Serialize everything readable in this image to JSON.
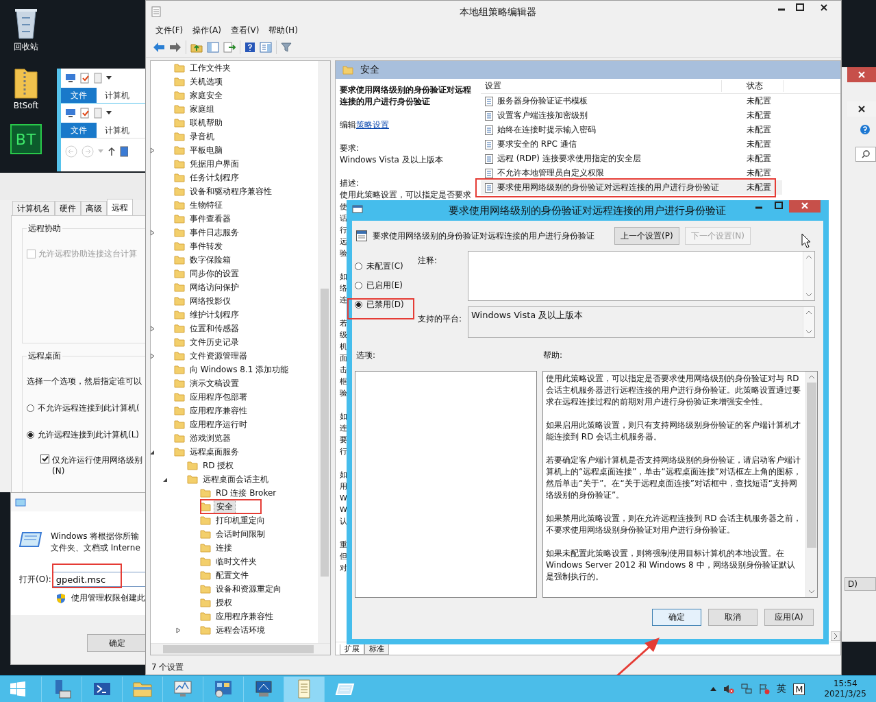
{
  "desktop": {
    "icons": [
      {
        "kind": "recycle-bin",
        "label": "回收站"
      },
      {
        "kind": "zip-folder",
        "label": "BtSoft"
      },
      {
        "kind": "tile",
        "tile_text": "BT"
      }
    ]
  },
  "explorer_windows": [
    {
      "ribbon_tabs": [
        "文件",
        "计算机"
      ]
    },
    {
      "ribbon_tabs": [
        "文件",
        "计算机"
      ]
    }
  ],
  "system_properties": {
    "tabs": [
      {
        "label": "计算机名",
        "selected": false
      },
      {
        "label": "硬件",
        "selected": false
      },
      {
        "label": "高级",
        "selected": false
      },
      {
        "label": "远程",
        "selected": true
      }
    ],
    "remote_assistance": {
      "title": "远程协助",
      "checkbox": {
        "label": "允许远程协助连接这台计算",
        "checked": false,
        "disabled": true
      }
    },
    "remote_desktop": {
      "title": "远程桌面",
      "hint": "选择一个选项，然后指定谁可以",
      "options": [
        {
          "label": "不允许远程连接到此计算机(",
          "selected": false
        },
        {
          "label": "允许远程连接到此计算机(L)",
          "selected": true
        }
      ],
      "nla_checkbox": {
        "label": "仅允许运行使用网络级别",
        "label_line2": "(N)",
        "checked": true,
        "disabled": false
      }
    }
  },
  "run_dialog": {
    "description": [
      "Windows 将根据你所输",
      "文件夹、文档或 Interne"
    ],
    "open_label": "打开(O):",
    "value": "gpedit.msc",
    "admin_note": "使用管理权限创建此",
    "ok_button": "确定"
  },
  "gpedit": {
    "title": "本地组策略编辑器",
    "menu": [
      "文件(F)",
      "操作(A)",
      "查看(V)",
      "帮助(H)"
    ],
    "tree": [
      {
        "label": "工作文件夹",
        "selected": false
      },
      {
        "label": "关机选项",
        "selected": false
      },
      {
        "label": "家庭安全",
        "selected": false
      },
      {
        "label": "家庭组",
        "selected": false
      },
      {
        "label": "联机帮助",
        "selected": false
      },
      {
        "label": "录音机",
        "selected": false
      },
      {
        "label": "平板电脑",
        "selected": false,
        "expanded": false
      },
      {
        "label": "凭据用户界面",
        "selected": false
      },
      {
        "label": "任务计划程序",
        "selected": false
      },
      {
        "label": "设备和驱动程序兼容性",
        "selected": false
      },
      {
        "label": "生物特征",
        "selected": false
      },
      {
        "label": "事件查看器",
        "selected": false
      },
      {
        "label": "事件日志服务",
        "selected": false,
        "expanded": false
      },
      {
        "label": "事件转发",
        "selected": false
      },
      {
        "label": "数字保险箱",
        "selected": false
      },
      {
        "label": "同步你的设置",
        "selected": false
      },
      {
        "label": "网络访问保护",
        "selected": false
      },
      {
        "label": "网络投影仪",
        "selected": false
      },
      {
        "label": "维护计划程序",
        "selected": false
      },
      {
        "label": "位置和传感器",
        "selected": false,
        "expanded": false
      },
      {
        "label": "文件历史记录",
        "selected": false
      },
      {
        "label": "文件资源管理器",
        "selected": false,
        "expanded": false
      },
      {
        "label": "向 Windows 8.1 添加功能",
        "selected": false
      },
      {
        "label": "演示文稿设置",
        "selected": false
      },
      {
        "label": "应用程序包部署",
        "selected": false
      },
      {
        "label": "应用程序兼容性",
        "selected": false
      },
      {
        "label": "应用程序运行时",
        "selected": false
      },
      {
        "label": "游戏浏览器",
        "selected": false
      },
      {
        "label": "远程桌面服务",
        "selected": false,
        "expanded": true,
        "children": [
          {
            "label": "RD 授权",
            "selected": false
          },
          {
            "label": "远程桌面会话主机",
            "selected": false,
            "expanded": true,
            "children": [
              {
                "label": "RD 连接 Broker",
                "selected": false
              },
              {
                "label": "安全",
                "selected": true
              },
              {
                "label": "打印机重定向",
                "selected": false
              },
              {
                "label": "会话时间限制",
                "selected": false
              },
              {
                "label": "连接",
                "selected": false
              },
              {
                "label": "临时文件夹",
                "selected": false
              },
              {
                "label": "配置文件",
                "selected": false
              },
              {
                "label": "设备和资源重定向",
                "selected": false
              },
              {
                "label": "授权",
                "selected": false
              },
              {
                "label": "应用程序兼容性",
                "selected": false
              },
              {
                "label": "远程会话环境",
                "selected": false,
                "expanded": false
              }
            ]
          }
        ]
      }
    ],
    "status": "7 个设置",
    "pane_header": "安全",
    "detail": {
      "title": "要求使用网络级别的身份验证对远程连接的用户进行身份验证",
      "edit_prefix": "编辑",
      "edit_link": "策略设置",
      "requirement_label": "要求:",
      "requirement": "Windows Vista 及以上版本",
      "description_label": "描述:",
      "description_first_line": "使用此策略设置，可以指定是否要求",
      "description_fragments": [
        [
          "使",
          "话",
          "行",
          "远",
          "验"
        ],
        [
          "如",
          "络",
          "连"
        ],
        [
          "若",
          "级",
          "机",
          "面",
          "击",
          "框",
          "验"
        ],
        [
          "如",
          "连",
          "要",
          "行"
        ],
        [
          "如",
          "用",
          "W",
          "W",
          "认"
        ],
        [
          "重",
          "但",
          "对"
        ]
      ]
    },
    "list": {
      "columns": [
        "设置",
        "状态"
      ],
      "rows": [
        {
          "name": "服务器身份验证证书模板",
          "state": "未配置",
          "selected": false
        },
        {
          "name": "设置客户端连接加密级别",
          "state": "未配置",
          "selected": false
        },
        {
          "name": "始终在连接时提示输入密码",
          "state": "未配置",
          "selected": false
        },
        {
          "name": "要求安全的 RPC 通信",
          "state": "未配置",
          "selected": false
        },
        {
          "name": "远程 (RDP) 连接要求使用指定的安全层",
          "state": "未配置",
          "selected": false
        },
        {
          "name": "不允许本地管理员自定义权限",
          "state": "未配置",
          "selected": false
        },
        {
          "name": "要求使用网络级别的身份验证对远程连接的用户进行身份验证",
          "state": "未配置",
          "selected": true
        }
      ]
    },
    "view_tabs": [
      {
        "label": "扩展",
        "selected": true
      },
      {
        "label": "标准",
        "selected": false
      }
    ]
  },
  "policy_dialog": {
    "title": "要求使用网络级别的身份验证对远程连接的用户进行身份验证",
    "heading": "要求使用网络级别的身份验证对远程连接的用户进行身份验证",
    "prev_button": {
      "label": "上一个设置(P)",
      "disabled": false
    },
    "next_button": {
      "label": "下一个设置(N)",
      "disabled": true
    },
    "options": [
      {
        "label": "未配置(C)",
        "selected": false
      },
      {
        "label": "已启用(E)",
        "selected": false
      },
      {
        "label": "已禁用(D)",
        "selected": true
      }
    ],
    "comment_label": "注释:",
    "platform_label": "支持的平台:",
    "platform": "Windows Vista 及以上版本",
    "options_label": "选项:",
    "help_label": "帮助:",
    "help": [
      "使用此策略设置，可以指定是否要求使用网络级别的身份验证对与 RD 会话主机服务器进行远程连接的用户进行身份验证。此策略设置通过要求在远程连接过程的前期对用户进行身份验证来增强安全性。",
      "如果启用此策略设置，则只有支持网络级别身份验证的客户端计算机才能连接到 RD 会话主机服务器。",
      "若要确定客户端计算机是否支持网络级别的身份验证，请启动客户端计算机上的“远程桌面连接”，单击“远程桌面连接”对话框左上角的图标，然后单击“关于”。在“关于远程桌面连接”对话框中，查找短语“支持网络级别的身份验证”。",
      "如果禁用此策略设置，则在允许远程连接到 RD 会话主机服务器之前，不要求使用网络级别身份验证对用户进行身份验证。",
      "如果未配置此策略设置，则将强制使用目标计算机的本地设置。在 Windows Server 2012 和 Windows 8 中，网络级别身份验证默认是强制执行的。"
    ],
    "buttons": [
      {
        "label": "确定",
        "default": true
      },
      {
        "label": "取消",
        "default": false
      },
      {
        "label": "应用(A)",
        "default": false
      }
    ]
  },
  "right_edge": {
    "button_fragment": "D)"
  },
  "taskbar": {
    "apps": [
      {
        "kind": "server",
        "selected": false
      },
      {
        "kind": "shell",
        "selected": false
      },
      {
        "kind": "folder",
        "selected": false
      },
      {
        "kind": "monitor",
        "selected": false
      },
      {
        "kind": "panel",
        "selected": false
      },
      {
        "kind": "remote",
        "selected": false
      },
      {
        "kind": "notepad",
        "selected": true
      },
      {
        "kind": "run",
        "selected": false
      }
    ],
    "tray": {
      "input_method": "英",
      "ime": "M",
      "time": "15:54",
      "date": "2021/3/25"
    }
  }
}
